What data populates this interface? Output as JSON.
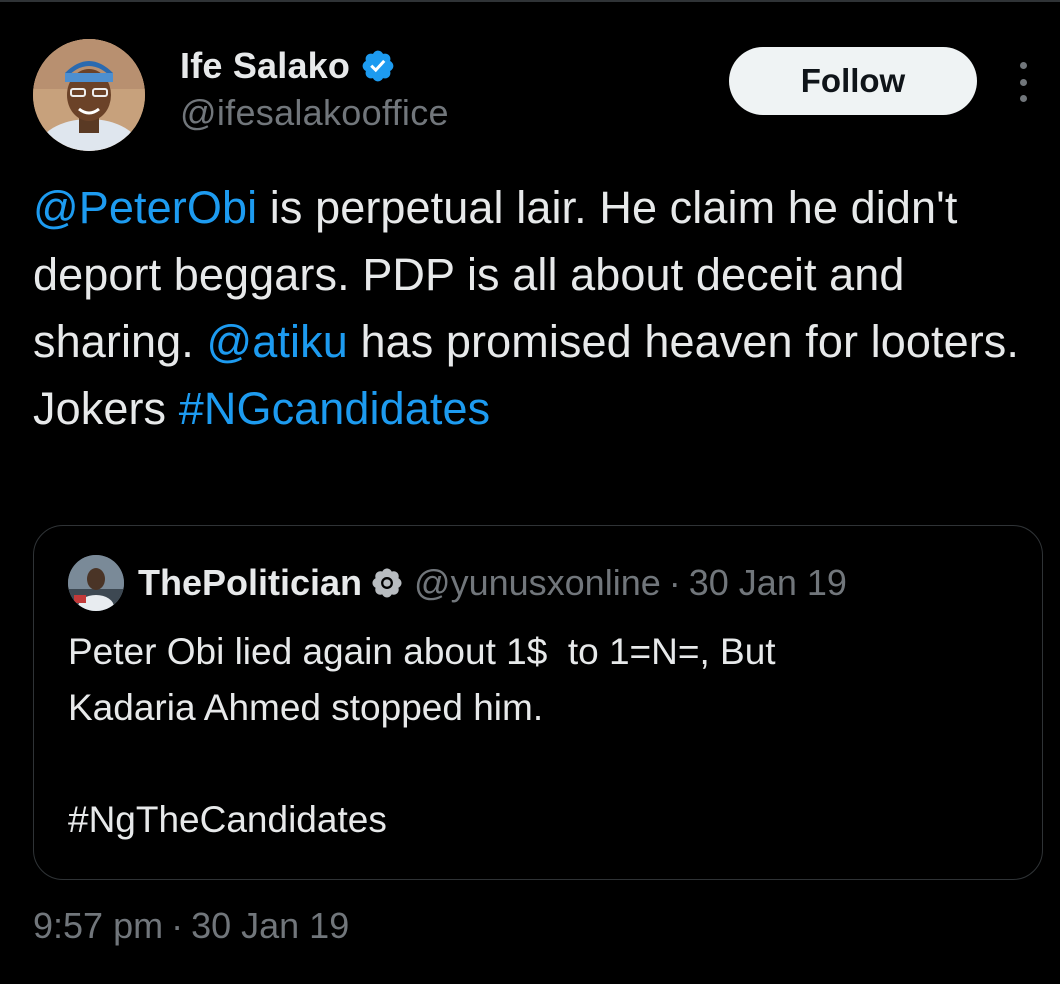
{
  "author": {
    "display_name": "Ife Salako",
    "handle": "@ifesalakooffice",
    "verified_icon": "verified-badge-icon",
    "avatar_icon": "avatar"
  },
  "actions": {
    "follow_label": "Follow",
    "more_icon": "more-vertical-icon"
  },
  "tweet": {
    "segments": [
      {
        "text": "@PeterObi",
        "type": "mention"
      },
      {
        "text": " is perpetual lair. He claim he didn't deport beggars. PDP is all about deceit and sharing. ",
        "type": "text"
      },
      {
        "text": "@atiku",
        "type": "mention"
      },
      {
        "text": " has promised heaven for looters. Jokers ",
        "type": "text"
      },
      {
        "text": "#NGcandidates",
        "type": "hashtag"
      }
    ]
  },
  "quote": {
    "display_name": "ThePolitician",
    "handle": "@yunusxonline",
    "separator": "·",
    "date": "30 Jan 19",
    "badge_icon": "gray-verified-badge-icon",
    "body_line1": "Peter Obi lied again about 1$  to 1=N=, But",
    "body_line2": "Kadaria Ahmed stopped him.",
    "body_hashtag": "#NgTheCandidates"
  },
  "footer": {
    "time": "9:57 pm",
    "separator": "·",
    "date": "30 Jan 19"
  },
  "colors": {
    "background": "#000000",
    "text": "#e7e9ea",
    "muted": "#71767b",
    "link": "#1d9bf0",
    "border": "#2f3336",
    "button_bg": "#eff3f4"
  }
}
